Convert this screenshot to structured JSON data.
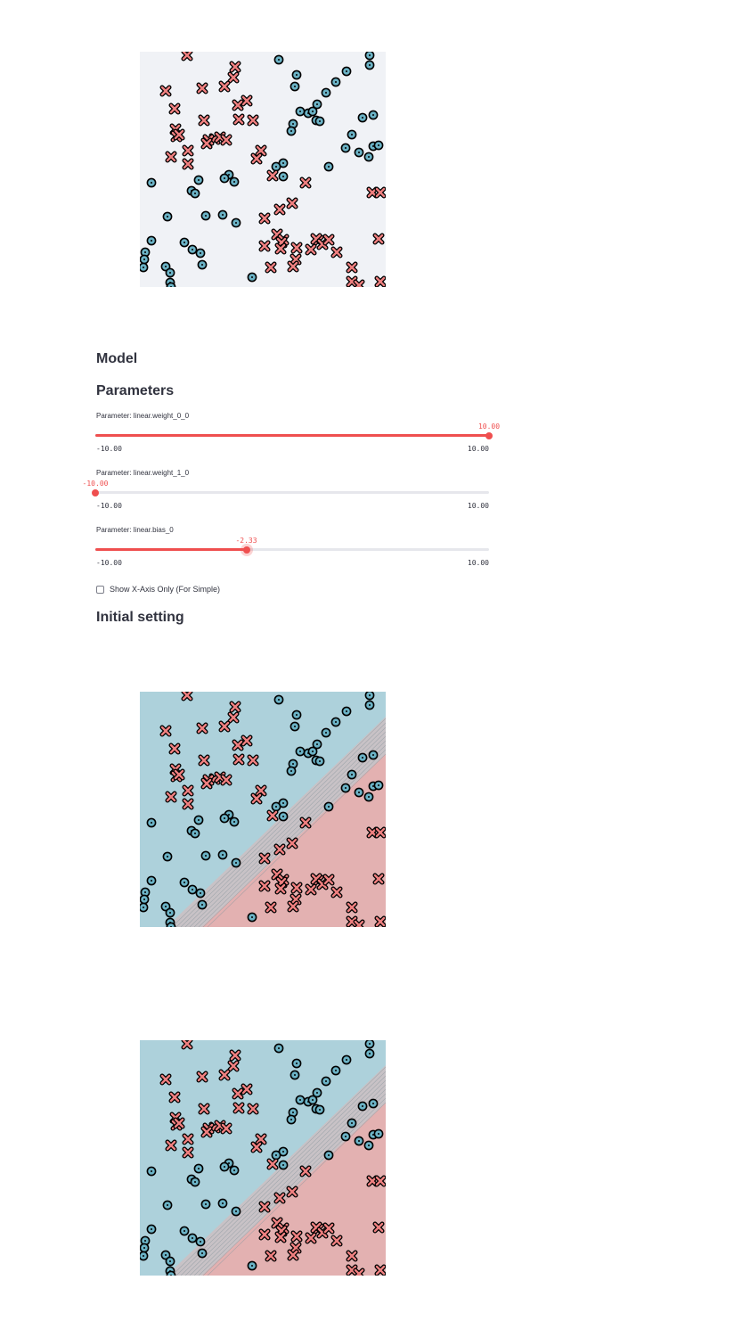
{
  "headings": {
    "model": "Model",
    "parameters": "Parameters",
    "initial_setting": "Initial setting"
  },
  "sliders": [
    {
      "label": "Parameter: linear.weight_0_0",
      "value": 10.0,
      "value_text": "10.00",
      "min": -10.0,
      "max": 10.0,
      "min_text": "-10.00",
      "max_text": "10.00"
    },
    {
      "label": "Parameter: linear.weight_1_0",
      "value": -10.0,
      "value_text": "-10.00",
      "min": -10.0,
      "max": 10.0,
      "min_text": "-10.00",
      "max_text": "10.00"
    },
    {
      "label": "Parameter: linear.bias_0",
      "value": -2.33,
      "value_text": "-2.33",
      "min": -10.0,
      "max": 10.0,
      "min_text": "-10.00",
      "max_text": "10.00"
    }
  ],
  "checkbox": {
    "label": "Show X-Axis Only (For Simple)",
    "checked": false
  },
  "colors": {
    "accent": "#EF4F4F",
    "track": "#E6E7EC",
    "class_circle": "#6BB3C6",
    "class_cross": "#F08080",
    "region_circle": "#ADD1DB",
    "region_cross": "#E3B1B1",
    "plot_background": "#F0F2F6"
  },
  "icons": {
    "circle_marker": "circle-dot-icon",
    "cross_marker": "cross-icon"
  },
  "plots": [
    {
      "name": "data-plot",
      "shows_decision_regions": false
    },
    {
      "name": "initial-setting-plot",
      "shows_decision_regions": true
    },
    {
      "name": "decision-boundary-plot",
      "shows_decision_regions": true
    }
  ]
}
